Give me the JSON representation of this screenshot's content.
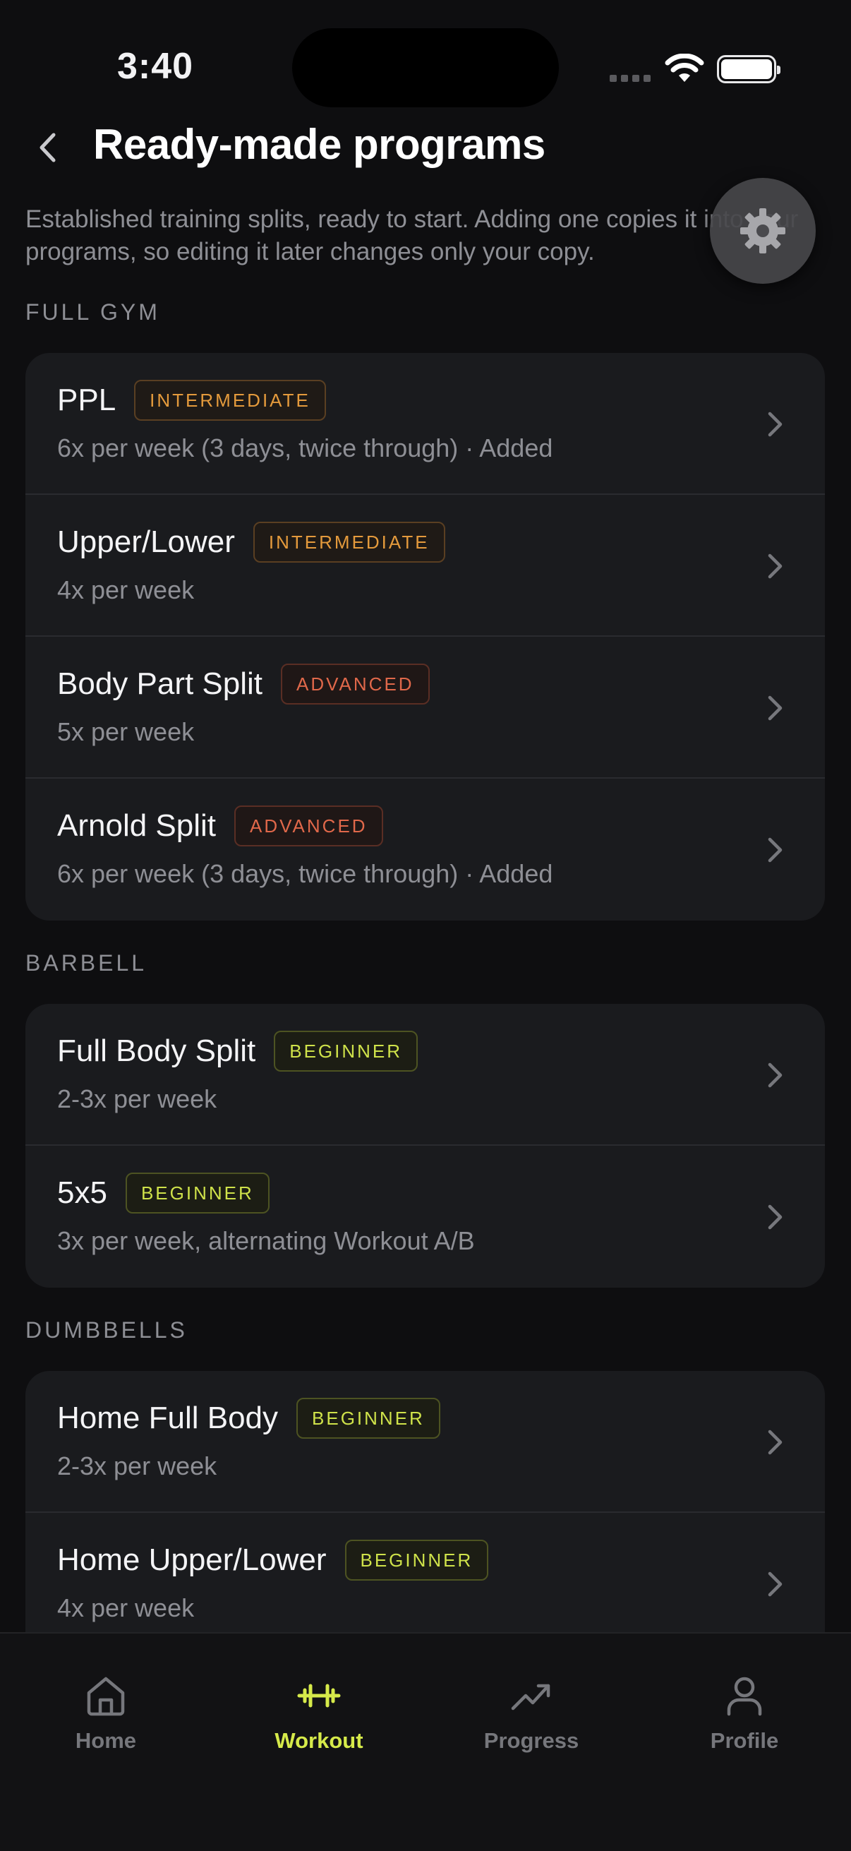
{
  "status_bar": {
    "time": "3:40"
  },
  "header": {
    "title": "Ready-made programs",
    "subtitle": "Established training splits, ready to start. Adding one copies it into your programs, so editing it later changes only your copy."
  },
  "sections": [
    {
      "title": "FULL GYM",
      "programs": [
        {
          "name": "PPL",
          "level": "INTERMEDIATE",
          "frequency": "6x per week (3 days, twice through) · Added"
        },
        {
          "name": "Upper/Lower",
          "level": "INTERMEDIATE",
          "frequency": "4x per week"
        },
        {
          "name": "Body Part Split",
          "level": "ADVANCED",
          "frequency": "5x per week"
        },
        {
          "name": "Arnold Split",
          "level": "ADVANCED",
          "frequency": "6x per week (3 days, twice through) · Added"
        }
      ]
    },
    {
      "title": "BARBELL",
      "programs": [
        {
          "name": "Full Body Split",
          "level": "BEGINNER",
          "frequency": "2-3x per week"
        },
        {
          "name": "5x5",
          "level": "BEGINNER",
          "frequency": "3x per week, alternating Workout A/B"
        }
      ]
    },
    {
      "title": "DUMBBELLS",
      "programs": [
        {
          "name": "Home Full Body",
          "level": "BEGINNER",
          "frequency": "2-3x per week"
        },
        {
          "name": "Home Upper/Lower",
          "level": "BEGINNER",
          "frequency": "4x per week"
        }
      ]
    }
  ],
  "tab_bar": {
    "tabs": [
      {
        "label": "Home",
        "icon": "home-icon",
        "active": false
      },
      {
        "label": "Workout",
        "icon": "dumbbell-icon",
        "active": true
      },
      {
        "label": "Progress",
        "icon": "trend-up-icon",
        "active": false
      },
      {
        "label": "Profile",
        "icon": "person-icon",
        "active": false
      }
    ]
  },
  "colors": {
    "background": "#0e0e10",
    "card": "#1a1b1e",
    "accent": "#d6ea4a",
    "intermediate": "#e49a3c",
    "advanced": "#e0684a",
    "beginner": "#cfe24a"
  }
}
